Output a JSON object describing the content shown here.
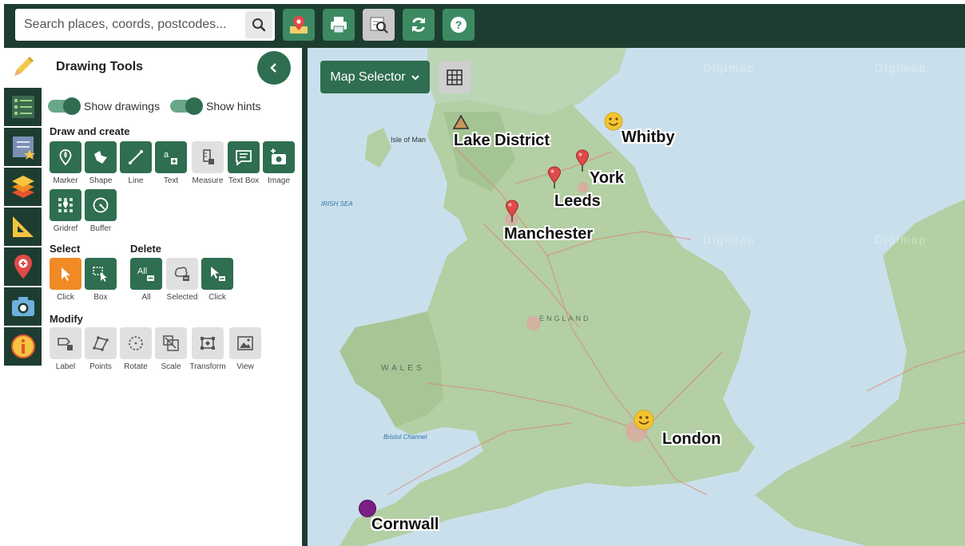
{
  "search": {
    "placeholder": "Search places, coords, postcodes..."
  },
  "toolbar": {
    "buttons": [
      {
        "name": "map-pin-icon"
      },
      {
        "name": "print-icon"
      },
      {
        "name": "zoom-map-icon"
      },
      {
        "name": "refresh-icon"
      },
      {
        "name": "help-icon"
      }
    ]
  },
  "rail": {
    "items": [
      "pencil-icon",
      "legend-list-icon",
      "saved-maps-icon",
      "layers-icon",
      "measure-ruler-icon",
      "location-pin-icon",
      "camera-icon",
      "info-icon"
    ]
  },
  "panel": {
    "title": "Drawing Tools",
    "toggles": {
      "show_drawings": "Show drawings",
      "show_hints": "Show hints"
    },
    "draw_and_create": {
      "heading": "Draw and create",
      "tools": [
        "Marker",
        "Shape",
        "Line",
        "Text",
        "Measure",
        "Text Box",
        "Image",
        "Gridref",
        "Buffer"
      ]
    },
    "select": {
      "heading": "Select",
      "tools": [
        "Click",
        "Box"
      ]
    },
    "delete": {
      "heading": "Delete",
      "tools": [
        "All",
        "Selected",
        "Click"
      ],
      "all_glyph": "All"
    },
    "modify": {
      "heading": "Modify",
      "tools": [
        "Label",
        "Points",
        "Rotate",
        "Scale",
        "Transform",
        "View"
      ]
    }
  },
  "map": {
    "selector_label": "Map Selector",
    "places": [
      "Lake District",
      "Whitby",
      "York",
      "Leeds",
      "Manchester",
      "London",
      "Cornwall"
    ],
    "basemap_labels": {
      "irish_sea": "IRISH SEA",
      "isle_of_man": "Isle of Man",
      "wales": "WALES",
      "england": "ENGLAND",
      "bristol_channel": "Bristol Channel",
      "watermark": "Digimap"
    }
  },
  "colors": {
    "header": "#1e3d31",
    "button_green": "#2f6e50",
    "select_active": "#f08a24",
    "marker_red": "#e04a48",
    "cornwall_marker": "#7b1e86",
    "smiley_yellow": "#f4c430"
  }
}
